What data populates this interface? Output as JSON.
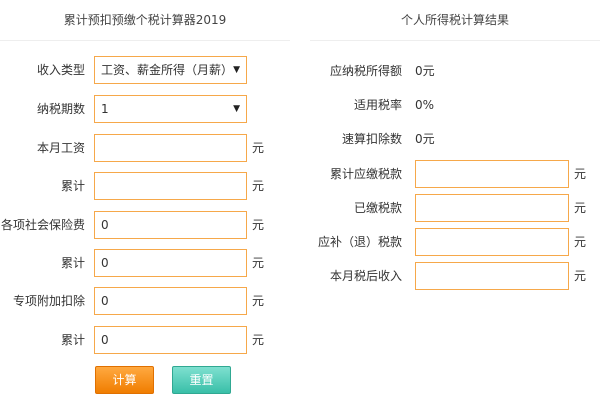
{
  "left": {
    "title": "累计预扣预缴个税计算器2019",
    "income_type": {
      "label": "收入类型",
      "value": "工资、薪金所得（月薪）"
    },
    "tax_period": {
      "label": "纳税期数",
      "value": "1"
    },
    "monthly_salary": {
      "label": "本月工资",
      "value": "",
      "unit": "元"
    },
    "salary_cumulative": {
      "label": "累计",
      "value": "",
      "unit": "元"
    },
    "social_insurance": {
      "label": "各项社会保险费",
      "value": "0",
      "unit": "元"
    },
    "insurance_cumulative": {
      "label": "累计",
      "value": "0",
      "unit": "元"
    },
    "special_deduction": {
      "label": "专项附加扣除",
      "value": "0",
      "unit": "元"
    },
    "deduction_cumulative": {
      "label": "累计",
      "value": "0",
      "unit": "元"
    },
    "buttons": {
      "calculate": "计算",
      "reset": "重置"
    }
  },
  "right": {
    "title": "个人所得税计算结果",
    "taxable_income": {
      "label": "应纳税所得额",
      "value": "0元"
    },
    "tax_rate": {
      "label": "适用税率",
      "value": "0%"
    },
    "quick_deduction": {
      "label": "速算扣除数",
      "value": "0元"
    },
    "cumulative_tax_due": {
      "label": "累计应缴税款",
      "value": "",
      "unit": "元"
    },
    "tax_paid": {
      "label": "已缴税款",
      "value": "",
      "unit": "元"
    },
    "tax_refund": {
      "label": "应补（退）税款",
      "value": "",
      "unit": "元"
    },
    "after_tax_income": {
      "label": "本月税后收入",
      "value": "",
      "unit": "元"
    }
  },
  "colors": {
    "accent_border": "#f6a84a",
    "calculate_button": "#f58a12",
    "reset_button": "#4ccab4"
  }
}
